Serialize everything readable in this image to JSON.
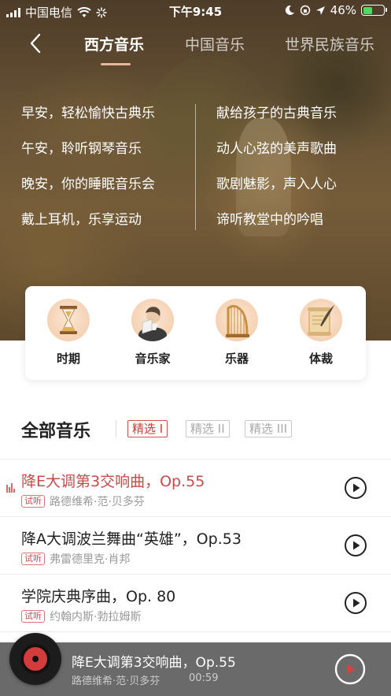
{
  "status": {
    "carrier": "中国电信",
    "time": "下午9:45",
    "battery": "46%"
  },
  "nav": {
    "tabs": [
      {
        "label": "西方音乐",
        "active": true
      },
      {
        "label": "中国音乐",
        "active": false
      },
      {
        "label": "世界民族音乐",
        "active": false
      }
    ]
  },
  "hero": {
    "left_items": [
      "早安，轻松愉快古典乐",
      "午安，聆听钢琴音乐",
      "晚安，你的睡眠音乐会",
      "戴上耳机，乐享运动"
    ],
    "right_items": [
      "献给孩子的古典音乐",
      "动人心弦的美声歌曲",
      "歌剧魅影，声入人心",
      "谛听教堂中的吟唱"
    ]
  },
  "categories": [
    {
      "label": "时期",
      "icon": "hourglass-icon"
    },
    {
      "label": "音乐家",
      "icon": "composer-icon"
    },
    {
      "label": "乐器",
      "icon": "harp-icon"
    },
    {
      "label": "体裁",
      "icon": "scroll-quill-icon"
    }
  ],
  "section": {
    "title": "全部音乐",
    "chips": [
      {
        "label": "精选 I",
        "active": true
      },
      {
        "label": "精选 II",
        "active": false
      },
      {
        "label": "精选 III",
        "active": false
      }
    ]
  },
  "tracks": [
    {
      "title": "降E大调第3交响曲，Op.55",
      "tag": "试听",
      "artist": "路德维希·范·贝多芬",
      "playing": true
    },
    {
      "title": "降A大调波兰舞曲“英雄”，Op.53",
      "tag": "试听",
      "artist": "弗雷德里克·肖邦",
      "playing": false
    },
    {
      "title": "学院庆典序曲，Op. 80",
      "tag": "试听",
      "artist": "约翰内斯·勃拉姆斯",
      "playing": false
    }
  ],
  "player": {
    "title": "降E大调第3交响曲，Op.55",
    "artist": "路德维希·范·贝多芬",
    "time": "00:59"
  },
  "colors": {
    "accent": "#c94a4a",
    "battery_fill": "#4cd964"
  }
}
